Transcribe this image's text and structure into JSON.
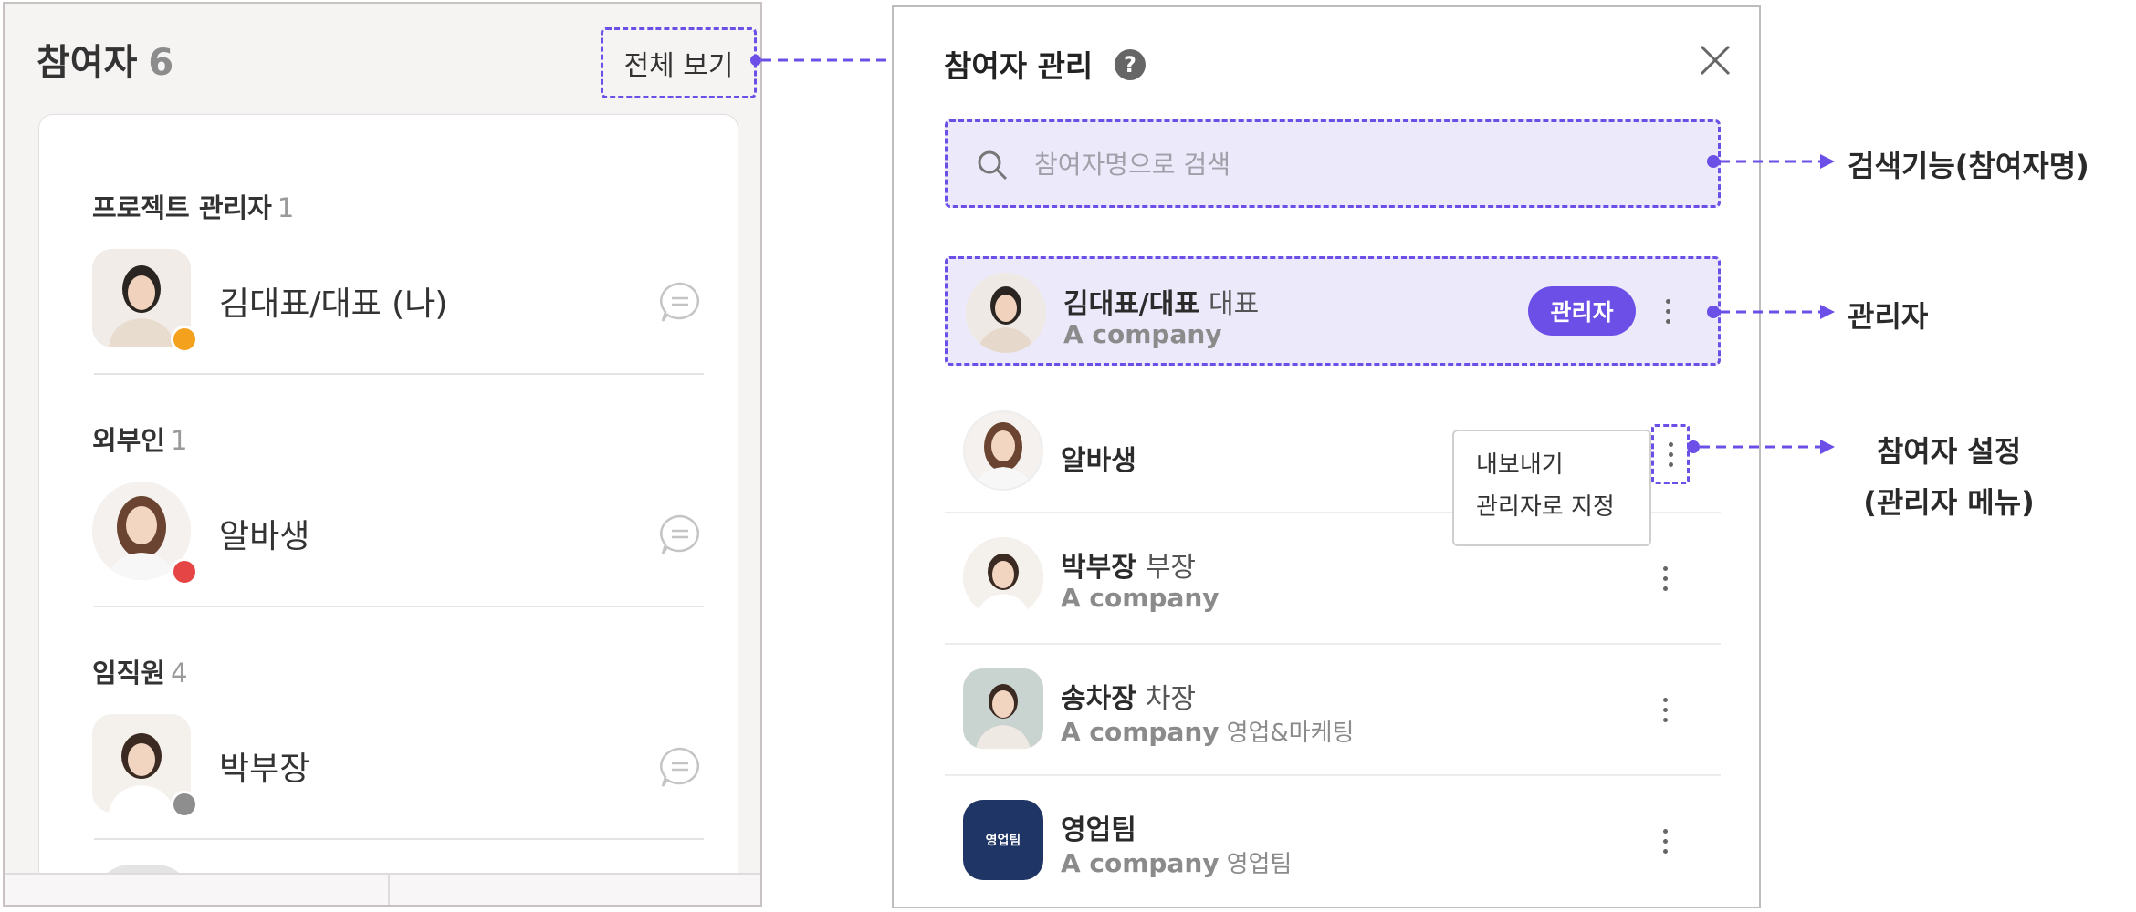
{
  "left_panel": {
    "title": "참여자",
    "count": "6",
    "view_all_label": "전체 보기",
    "sections": [
      {
        "label": "프로젝트 관리자",
        "count": "1",
        "member": {
          "name": "김대표/대표 (나)",
          "status_color": "#f4a21d"
        }
      },
      {
        "label": "외부인",
        "count": "1",
        "member": {
          "name": "알바생",
          "status_color": "#e64545"
        }
      },
      {
        "label": "임직원",
        "count": "4",
        "member": {
          "name": "박부장",
          "status_color": "#8e8e8e"
        }
      }
    ]
  },
  "dialog": {
    "title": "참여자 관리",
    "help_icon_text": "?",
    "search_placeholder": "참여자명으로 검색",
    "members": [
      {
        "name": "김대표/대표",
        "title": "대표",
        "company": "A company",
        "dept": "",
        "badge": "관리자"
      },
      {
        "name": "알바생",
        "title": "",
        "company": "",
        "dept": ""
      },
      {
        "name": "박부장",
        "title": "부장",
        "company": "A company",
        "dept": ""
      },
      {
        "name": "송차장",
        "title": "차장",
        "company": "A company",
        "dept": "영업&마케팅"
      },
      {
        "name": "영업팀",
        "title": "",
        "company": "A company",
        "dept": "영업팀",
        "avatar_text": "영업팀"
      }
    ],
    "context_menu": [
      "내보내기",
      "관리자로 지정"
    ]
  },
  "annotations": {
    "search": "검색기능(참여자명)",
    "admin": "관리자",
    "settings_line1": "참여자 설정",
    "settings_line2": "(관리자 메뉴)"
  },
  "colors": {
    "accent": "#6b4fe6",
    "highlight_bg": "#ece9fb",
    "team_avatar_bg": "#1f3566"
  }
}
